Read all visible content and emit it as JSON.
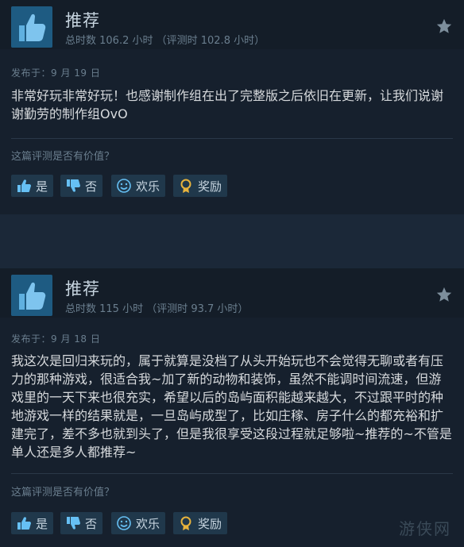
{
  "reviews": [
    {
      "recommendation": "推荐",
      "hours": "总时数 106.2 小时  （评测时 102.8 小时）",
      "posted": "发布于：9 月 19 日",
      "text": "非常好玩非常好玩！也感谢制作组在出了完整版之后依旧在更新，让我们说谢谢勤劳的制作组OvO",
      "helpful_prompt": "这篇评测是否有价值？",
      "buttons": {
        "yes": "是",
        "no": "否",
        "funny": "欢乐",
        "award": "奖励"
      }
    },
    {
      "recommendation": "推荐",
      "hours": "总时数 115 小时  （评测时 93.7 小时）",
      "posted": "发布于：9 月 18 日",
      "text": "我这次是回归来玩的，属于就算是没档了从头开始玩也不会觉得无聊或者有压力的那种游戏，很适合我~加了新的动物和装饰，虽然不能调时间流速，但游戏里的一天下来也很充实，希望以后的岛屿面积能越来越大，不过跟平时的种地游戏一样的结果就是，一旦岛屿成型了，比如庄稼、房子什么的都充裕和扩建完了，差不多也就到头了，但是我很享受这段过程就足够啦~推荐的~不管是单人还是多人都推荐~",
      "helpful_prompt": "这篇评测是否有价值？",
      "buttons": {
        "yes": "是",
        "no": "否",
        "funny": "欢乐",
        "award": "奖励"
      }
    }
  ],
  "watermark": "游侠网",
  "icons": [
    "thumbs-up-icon",
    "star-icon",
    "thumb-up-small-icon",
    "thumb-down-small-icon",
    "smile-icon",
    "award-icon"
  ],
  "colors": {
    "background": "#1b2838",
    "card": "#16202d",
    "accent": "#66c0f4",
    "award": "#e8b33c"
  }
}
